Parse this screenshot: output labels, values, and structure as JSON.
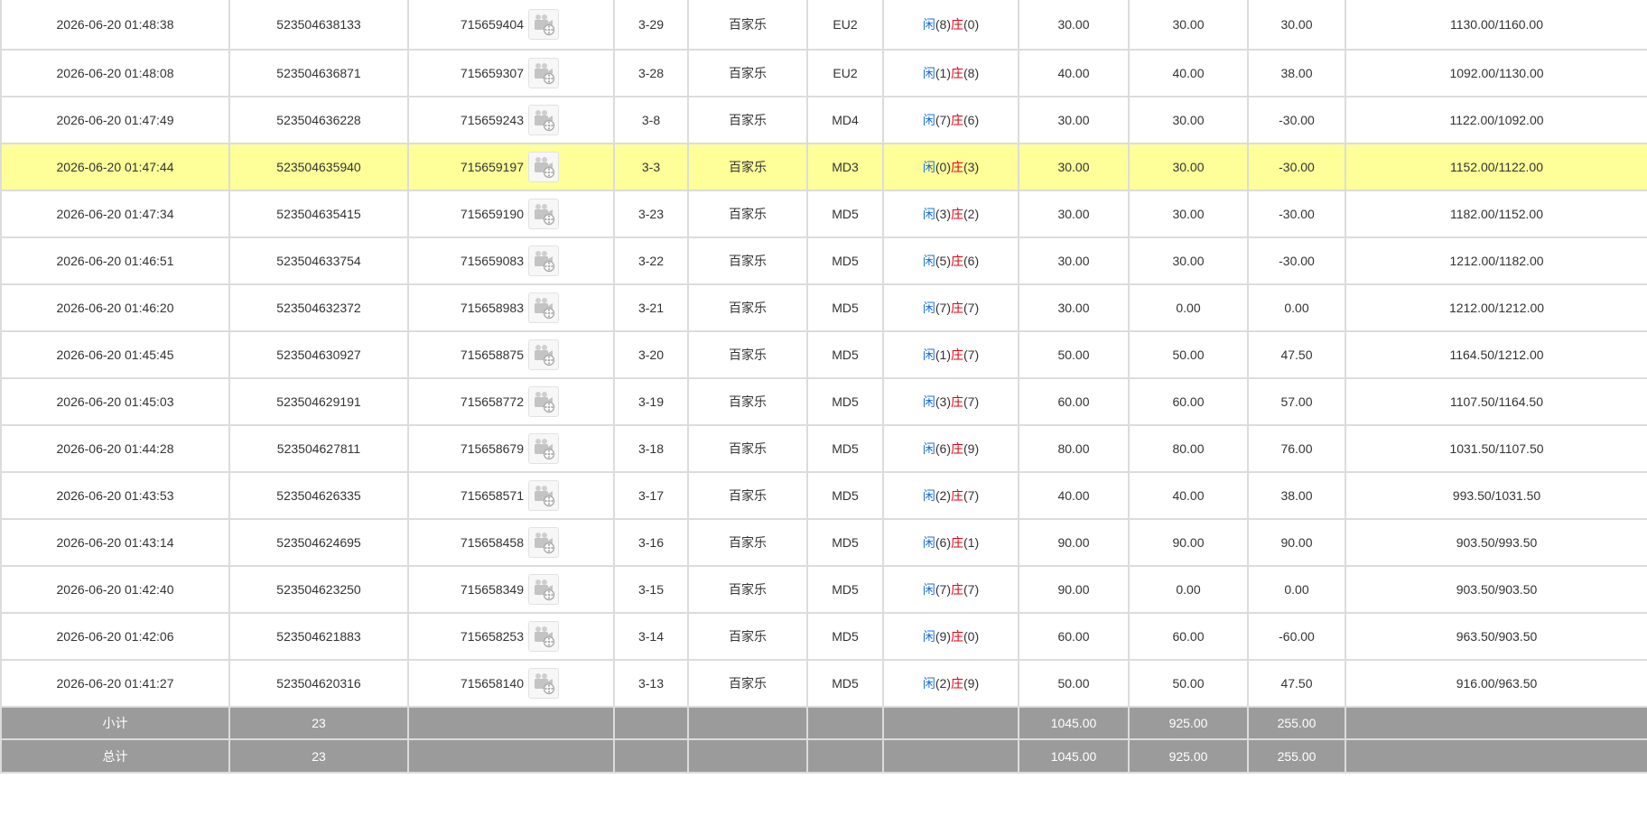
{
  "rows": [
    {
      "time": "2026-06-20 01:48:38",
      "order_no": "523504638133",
      "round_id": "715659404",
      "shoe": "3-29",
      "game": "百家乐",
      "table": "EU2",
      "player_label": "闲",
      "player_pts": "(8)",
      "banker_label": "庄",
      "banker_pts": "(0)",
      "bet": "30.00",
      "valid_bet": "30.00",
      "winloss": "30.00",
      "winloss_negative": false,
      "balance": "1130.00/1160.00",
      "highlight": false
    },
    {
      "time": "2026-06-20 01:48:08",
      "order_no": "523504636871",
      "round_id": "715659307",
      "shoe": "3-28",
      "game": "百家乐",
      "table": "EU2",
      "player_label": "闲",
      "player_pts": "(1)",
      "banker_label": "庄",
      "banker_pts": "(8)",
      "bet": "40.00",
      "valid_bet": "40.00",
      "winloss": "38.00",
      "winloss_negative": false,
      "balance": "1092.00/1130.00",
      "highlight": false
    },
    {
      "time": "2026-06-20 01:47:49",
      "order_no": "523504636228",
      "round_id": "715659243",
      "shoe": "3-8",
      "game": "百家乐",
      "table": "MD4",
      "player_label": "闲",
      "player_pts": "(7)",
      "banker_label": "庄",
      "banker_pts": "(6)",
      "bet": "30.00",
      "valid_bet": "30.00",
      "winloss": "-30.00",
      "winloss_negative": true,
      "balance": "1122.00/1092.00",
      "highlight": false
    },
    {
      "time": "2026-06-20 01:47:44",
      "order_no": "523504635940",
      "round_id": "715659197",
      "shoe": "3-3",
      "game": "百家乐",
      "table": "MD3",
      "player_label": "闲",
      "player_pts": "(0)",
      "banker_label": "庄",
      "banker_pts": "(3)",
      "bet": "30.00",
      "valid_bet": "30.00",
      "winloss": "-30.00",
      "winloss_negative": true,
      "balance": "1152.00/1122.00",
      "highlight": true
    },
    {
      "time": "2026-06-20 01:47:34",
      "order_no": "523504635415",
      "round_id": "715659190",
      "shoe": "3-23",
      "game": "百家乐",
      "table": "MD5",
      "player_label": "闲",
      "player_pts": "(3)",
      "banker_label": "庄",
      "banker_pts": "(2)",
      "bet": "30.00",
      "valid_bet": "30.00",
      "winloss": "-30.00",
      "winloss_negative": true,
      "balance": "1182.00/1152.00",
      "highlight": false
    },
    {
      "time": "2026-06-20 01:46:51",
      "order_no": "523504633754",
      "round_id": "715659083",
      "shoe": "3-22",
      "game": "百家乐",
      "table": "MD5",
      "player_label": "闲",
      "player_pts": "(5)",
      "banker_label": "庄",
      "banker_pts": "(6)",
      "bet": "30.00",
      "valid_bet": "30.00",
      "winloss": "-30.00",
      "winloss_negative": true,
      "balance": "1212.00/1182.00",
      "highlight": false
    },
    {
      "time": "2026-06-20 01:46:20",
      "order_no": "523504632372",
      "round_id": "715658983",
      "shoe": "3-21",
      "game": "百家乐",
      "table": "MD5",
      "player_label": "闲",
      "player_pts": "(7)",
      "banker_label": "庄",
      "banker_pts": "(7)",
      "bet": "30.00",
      "valid_bet": "0.00",
      "winloss": "0.00",
      "winloss_negative": false,
      "balance": "1212.00/1212.00",
      "highlight": false
    },
    {
      "time": "2026-06-20 01:45:45",
      "order_no": "523504630927",
      "round_id": "715658875",
      "shoe": "3-20",
      "game": "百家乐",
      "table": "MD5",
      "player_label": "闲",
      "player_pts": "(1)",
      "banker_label": "庄",
      "banker_pts": "(7)",
      "bet": "50.00",
      "valid_bet": "50.00",
      "winloss": "47.50",
      "winloss_negative": false,
      "balance": "1164.50/1212.00",
      "highlight": false
    },
    {
      "time": "2026-06-20 01:45:03",
      "order_no": "523504629191",
      "round_id": "715658772",
      "shoe": "3-19",
      "game": "百家乐",
      "table": "MD5",
      "player_label": "闲",
      "player_pts": "(3)",
      "banker_label": "庄",
      "banker_pts": "(7)",
      "bet": "60.00",
      "valid_bet": "60.00",
      "winloss": "57.00",
      "winloss_negative": false,
      "balance": "1107.50/1164.50",
      "highlight": false
    },
    {
      "time": "2026-06-20 01:44:28",
      "order_no": "523504627811",
      "round_id": "715658679",
      "shoe": "3-18",
      "game": "百家乐",
      "table": "MD5",
      "player_label": "闲",
      "player_pts": "(6)",
      "banker_label": "庄",
      "banker_pts": "(9)",
      "bet": "80.00",
      "valid_bet": "80.00",
      "winloss": "76.00",
      "winloss_negative": false,
      "balance": "1031.50/1107.50",
      "highlight": false
    },
    {
      "time": "2026-06-20 01:43:53",
      "order_no": "523504626335",
      "round_id": "715658571",
      "shoe": "3-17",
      "game": "百家乐",
      "table": "MD5",
      "player_label": "闲",
      "player_pts": "(2)",
      "banker_label": "庄",
      "banker_pts": "(7)",
      "bet": "40.00",
      "valid_bet": "40.00",
      "winloss": "38.00",
      "winloss_negative": false,
      "balance": "993.50/1031.50",
      "highlight": false
    },
    {
      "time": "2026-06-20 01:43:14",
      "order_no": "523504624695",
      "round_id": "715658458",
      "shoe": "3-16",
      "game": "百家乐",
      "table": "MD5",
      "player_label": "闲",
      "player_pts": "(6)",
      "banker_label": "庄",
      "banker_pts": "(1)",
      "bet": "90.00",
      "valid_bet": "90.00",
      "winloss": "90.00",
      "winloss_negative": false,
      "balance": "903.50/993.50",
      "highlight": false
    },
    {
      "time": "2026-06-20 01:42:40",
      "order_no": "523504623250",
      "round_id": "715658349",
      "shoe": "3-15",
      "game": "百家乐",
      "table": "MD5",
      "player_label": "闲",
      "player_pts": "(7)",
      "banker_label": "庄",
      "banker_pts": "(7)",
      "bet": "90.00",
      "valid_bet": "0.00",
      "winloss": "0.00",
      "winloss_negative": false,
      "balance": "903.50/903.50",
      "highlight": false
    },
    {
      "time": "2026-06-20 01:42:06",
      "order_no": "523504621883",
      "round_id": "715658253",
      "shoe": "3-14",
      "game": "百家乐",
      "table": "MD5",
      "player_label": "闲",
      "player_pts": "(9)",
      "banker_label": "庄",
      "banker_pts": "(0)",
      "bet": "60.00",
      "valid_bet": "60.00",
      "winloss": "-60.00",
      "winloss_negative": true,
      "balance": "963.50/903.50",
      "highlight": false
    },
    {
      "time": "2026-06-20 01:41:27",
      "order_no": "523504620316",
      "round_id": "715658140",
      "shoe": "3-13",
      "game": "百家乐",
      "table": "MD5",
      "player_label": "闲",
      "player_pts": "(2)",
      "banker_label": "庄",
      "banker_pts": "(9)",
      "bet": "50.00",
      "valid_bet": "50.00",
      "winloss": "47.50",
      "winloss_negative": false,
      "balance": "916.00/963.50",
      "highlight": false
    }
  ],
  "subtotal": {
    "label": "小计",
    "count": "23",
    "bet": "1045.00",
    "valid_bet": "925.00",
    "winloss": "255.00"
  },
  "total": {
    "label": "总计",
    "count": "23",
    "bet": "1045.00",
    "valid_bet": "925.00",
    "winloss": "255.00"
  },
  "colors": {
    "player": "#1a6ed8",
    "banker": "#e60012",
    "bet": "#1a6ed8",
    "negative": "#e60012",
    "highlight_row": "#ffff99",
    "summary_bg": "#9b9b9b"
  },
  "icons": {
    "replay": "video-replay-icon"
  }
}
